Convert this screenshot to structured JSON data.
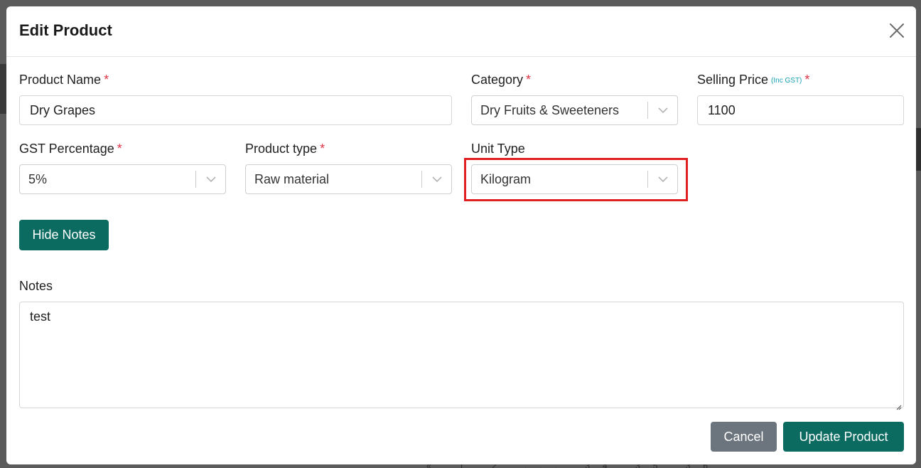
{
  "background": {
    "pagination_text": "« 1 2 ... 34 35 36 »"
  },
  "modal": {
    "title": "Edit Product",
    "close_icon": "close-icon"
  },
  "form": {
    "product_name": {
      "label": "Product Name",
      "required": "*",
      "value": "Dry Grapes"
    },
    "category": {
      "label": "Category",
      "required": "*",
      "value": "Dry Fruits & Sweeteners"
    },
    "selling_price": {
      "label": "Selling Price",
      "hint": "(Inc GST)",
      "required": "*",
      "value": "1100"
    },
    "gst_percentage": {
      "label": "GST Percentage",
      "required": "*",
      "value": "5%"
    },
    "product_type": {
      "label": "Product type",
      "required": "*",
      "value": "Raw material"
    },
    "unit_type": {
      "label": "Unit Type",
      "value": "Kilogram"
    },
    "hide_notes_label": "Hide Notes",
    "notes": {
      "label": "Notes",
      "value": "test"
    }
  },
  "footer": {
    "cancel_label": "Cancel",
    "update_label": "Update Product"
  },
  "colors": {
    "primary": "#0b6b61",
    "secondary": "#6c757d",
    "required": "#dc3545",
    "highlight": "#e02020",
    "hint": "#17a2b8"
  }
}
